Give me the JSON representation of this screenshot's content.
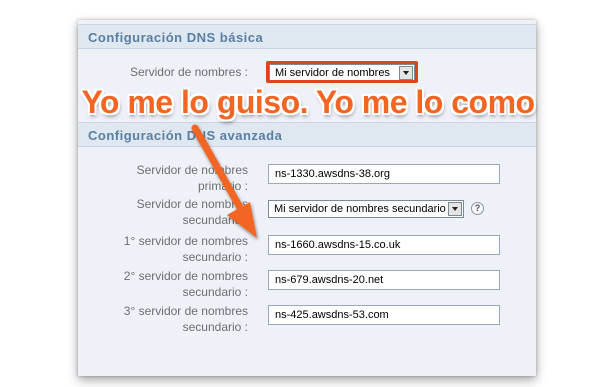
{
  "basic": {
    "title": "Configuración DNS básica",
    "nameserver_label": "Servidor de nombres :",
    "nameserver_selected": "Mi servidor de nombres"
  },
  "caption": "Yo me lo guiso. Yo me lo como",
  "advanced": {
    "title": "Configuración DNS avanzada",
    "primary_label_1": "Servidor de nombres",
    "primary_label_2": "primario :",
    "primary_value": "ns-1330.awsdns-38.org",
    "secondary_label_1": "Servidor de nombres",
    "secondary_label_2": "secundario :",
    "secondary_selected": "Mi servidor de nombres secundario",
    "help_glyph": "?",
    "ns1_label_1": "1° servidor de nombres",
    "ns1_label_2": "secundario :",
    "ns1_value": "ns-1660.awsdns-15.co.uk",
    "ns2_label_1": "2° servidor de nombres",
    "ns2_label_2": "secundario :",
    "ns2_value": "ns-679.awsdns-20.net",
    "ns3_label_1": "3° servidor de nombres",
    "ns3_label_2": "secundario :",
    "ns3_value": "ns-425.awsdns-53.com"
  },
  "colors": {
    "highlight": "#d8461c",
    "caption": "#f26522",
    "section_title": "#5a7fa3"
  },
  "icons": {
    "arrow": "annotation-arrow-icon",
    "help": "help-icon",
    "dropdown": "chevron-down-icon"
  }
}
